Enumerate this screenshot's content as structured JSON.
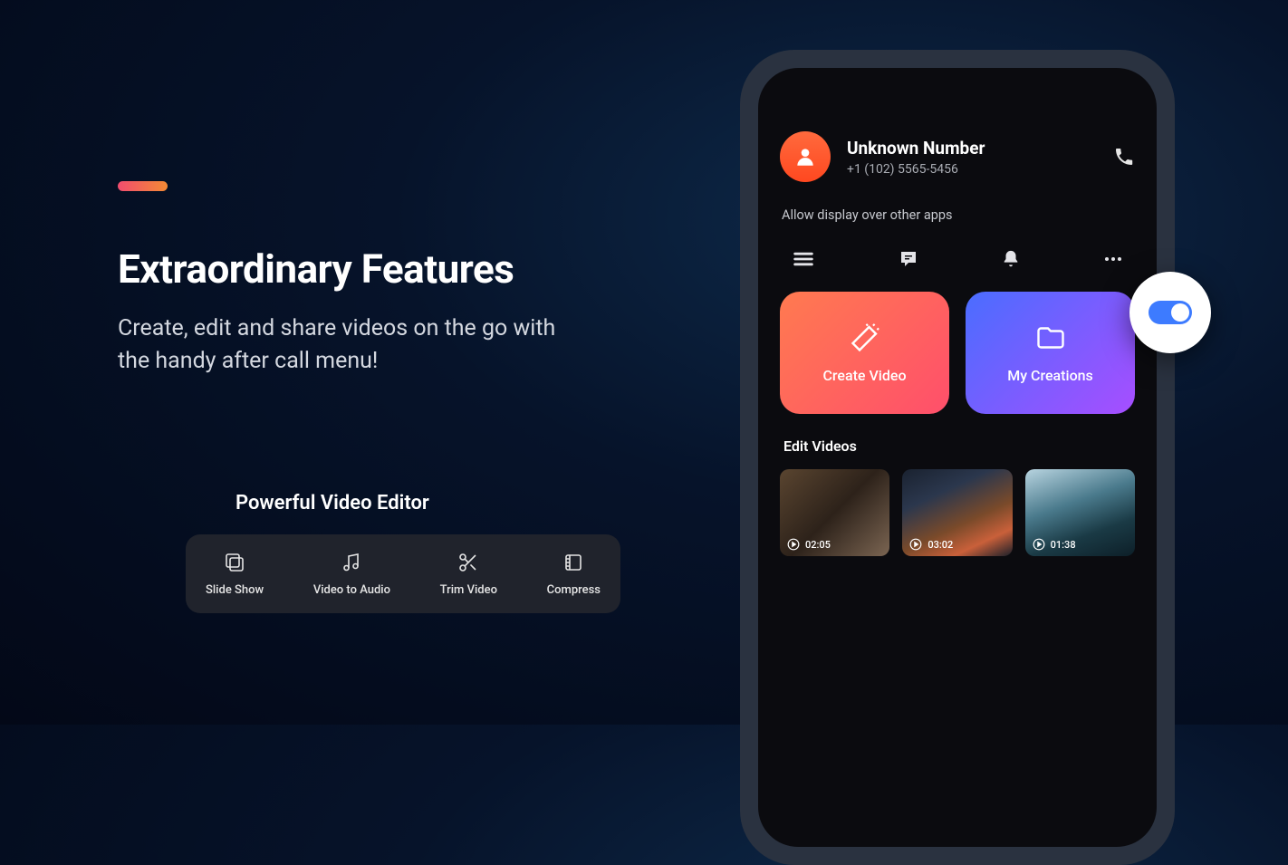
{
  "marketing": {
    "headline": "Extraordinary Features",
    "subcopy": "Create, edit and share videos on the go with the handy after call menu!",
    "editor_label": "Powerful Video Editor",
    "tools": [
      {
        "name": "slideshow",
        "label": "Slide Show"
      },
      {
        "name": "video-to-audio",
        "label": "Video to Audio"
      },
      {
        "name": "trim-video",
        "label": "Trim Video"
      },
      {
        "name": "compress",
        "label": "Compress"
      }
    ]
  },
  "phone": {
    "caller": {
      "name": "Unknown Number",
      "number": "+1 (102) 5565-5456"
    },
    "allow_text": "Allow display over other apps",
    "cards": {
      "create": "Create Video",
      "creations": "My Creations"
    },
    "section_label": "Edit Videos",
    "videos": [
      {
        "duration": "02:05"
      },
      {
        "duration": "03:02"
      },
      {
        "duration": "01:38"
      }
    ]
  }
}
